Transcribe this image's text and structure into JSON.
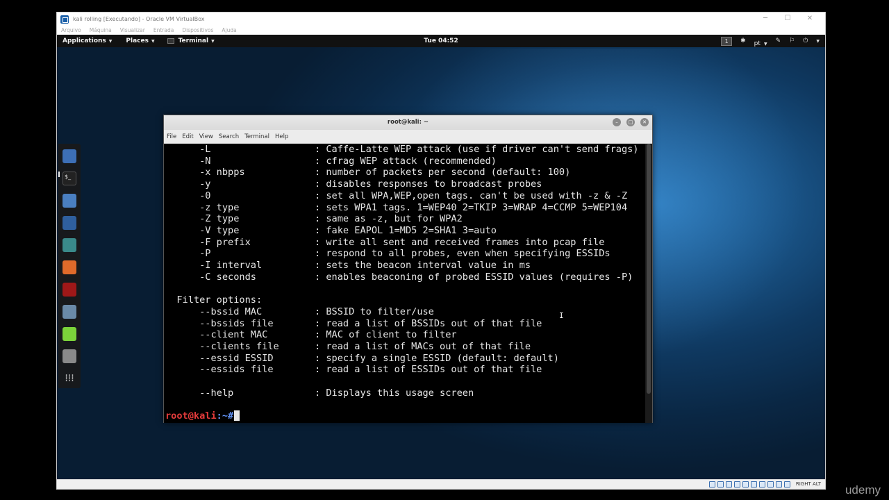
{
  "vbox": {
    "title": "kali rolling [Executando] - Oracle VM VirtualBox",
    "menu": [
      "Arquivo",
      "Máquina",
      "Visualizar",
      "Entrada",
      "Dispositivos",
      "Ajuda"
    ],
    "host_key": "RIGHT ALT",
    "controls": [
      "─",
      "☐",
      "✕"
    ]
  },
  "topbar": {
    "applications": "Applications",
    "places": "Places",
    "terminal": "Terminal",
    "clock": "Tue 04:52",
    "workspace": "1",
    "language": "pt"
  },
  "terminal": {
    "title": "root@kali: ~",
    "menu": [
      "File",
      "Edit",
      "View",
      "Search",
      "Terminal",
      "Help"
    ],
    "lines": [
      {
        "opt": "      -L",
        "desc": ": Caffe-Latte WEP attack (use if driver can't send frags)"
      },
      {
        "opt": "      -N",
        "desc": ": cfrag WEP attack (recommended)"
      },
      {
        "opt": "      -x nbpps",
        "desc": ": number of packets per second (default: 100)"
      },
      {
        "opt": "      -y",
        "desc": ": disables responses to broadcast probes"
      },
      {
        "opt": "      -0",
        "desc": ": set all WPA,WEP,open tags. can't be used with -z & -Z"
      },
      {
        "opt": "      -z type",
        "desc": ": sets WPA1 tags. 1=WEP40 2=TKIP 3=WRAP 4=CCMP 5=WEP104"
      },
      {
        "opt": "      -Z type",
        "desc": ": same as -z, but for WPA2"
      },
      {
        "opt": "      -V type",
        "desc": ": fake EAPOL 1=MD5 2=SHA1 3=auto"
      },
      {
        "opt": "      -F prefix",
        "desc": ": write all sent and received frames into pcap file"
      },
      {
        "opt": "      -P",
        "desc": ": respond to all probes, even when specifying ESSIDs"
      },
      {
        "opt": "      -I interval",
        "desc": ": sets the beacon interval value in ms"
      },
      {
        "opt": "      -C seconds",
        "desc": ": enables beaconing of probed ESSID values (requires -P)"
      },
      {
        "opt": "",
        "desc": ""
      },
      {
        "opt": "  Filter options:",
        "desc": ""
      },
      {
        "opt": "      --bssid MAC",
        "desc": ": BSSID to filter/use"
      },
      {
        "opt": "      --bssids file",
        "desc": ": read a list of BSSIDs out of that file"
      },
      {
        "opt": "      --client MAC",
        "desc": ": MAC of client to filter"
      },
      {
        "opt": "      --clients file",
        "desc": ": read a list of MACs out of that file"
      },
      {
        "opt": "      --essid ESSID",
        "desc": ": specify a single ESSID (default: default)"
      },
      {
        "opt": "      --essids file",
        "desc": ": read a list of ESSIDs out of that file"
      },
      {
        "opt": "",
        "desc": ""
      },
      {
        "opt": "      --help",
        "desc": ": Displays this usage screen"
      }
    ],
    "prompt_user": "root@kali",
    "prompt_path": ":~#"
  },
  "dock": {
    "items": [
      {
        "name": "dock-browser",
        "color": "#3d6fb6"
      },
      {
        "name": "dock-terminal",
        "color": "#222222"
      },
      {
        "name": "dock-files",
        "color": "#4a7fc1"
      },
      {
        "name": "dock-metasploit",
        "color": "#2f5f9e"
      },
      {
        "name": "dock-armitage",
        "color": "#3a8a8a"
      },
      {
        "name": "dock-burpsuite",
        "color": "#e06a2a"
      },
      {
        "name": "dock-maltego",
        "color": "#a01818"
      },
      {
        "name": "dock-beef",
        "color": "#6a8aa8"
      },
      {
        "name": "dock-notes",
        "color": "#7bd33a"
      },
      {
        "name": "dock-kazam",
        "color": "#8a8a8a"
      },
      {
        "name": "dock-show-apps",
        "color": "#cccccc"
      }
    ]
  },
  "watermark": "udemy"
}
